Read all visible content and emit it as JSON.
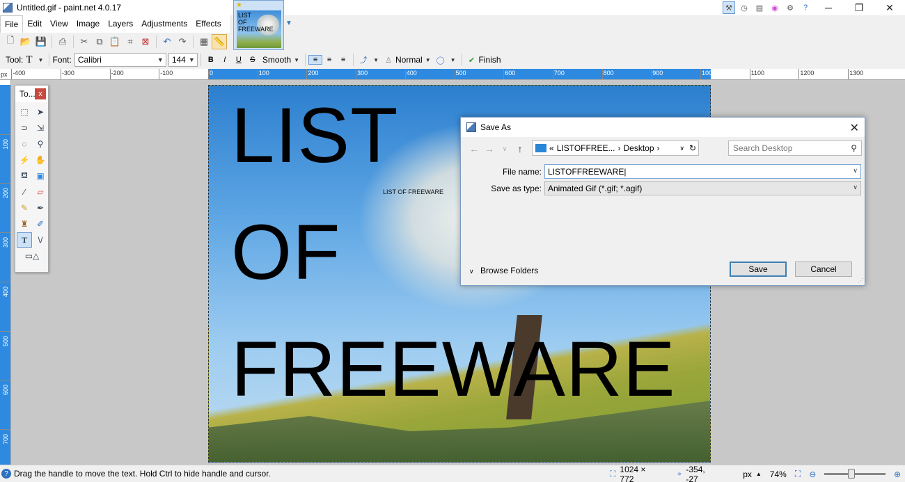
{
  "window": {
    "title": "Untitled.gif - paint.net 4.0.17",
    "minimize": "─",
    "restore": "❐",
    "close": "✕"
  },
  "menu": [
    "File",
    "Edit",
    "View",
    "Image",
    "Layers",
    "Adjustments",
    "Effects"
  ],
  "image_tab": {
    "thumb_text": "LIST\nOF\nFREEWARE"
  },
  "toolbar2": {
    "tool_label": "Tool:",
    "tool_icon": "T",
    "font_label": "Font:",
    "font_value": "Calibri",
    "size_value": "144",
    "bold": "B",
    "italic": "I",
    "underline": "U",
    "strike": "S",
    "antialias": "Smooth",
    "blend": "Normal",
    "finish": "Finish"
  },
  "ruler": {
    "unit": "px",
    "h_labels": [
      "-400",
      "-300",
      "-200",
      "-100",
      "0",
      "100",
      "200",
      "300",
      "400",
      "500",
      "600",
      "700",
      "800",
      "900",
      "1000",
      "1100",
      "1200",
      "1300"
    ],
    "v_labels": [
      "100",
      "200",
      "300",
      "400",
      "500",
      "600",
      "700"
    ]
  },
  "tools_window": {
    "title": "To...",
    "close": "x",
    "icons": [
      "rectangle-select-icon",
      "move-selection-icon",
      "lasso-select-icon",
      "move-selected-icon",
      "ellipse-select-icon",
      "zoom-icon",
      "magic-wand-icon",
      "pan-icon",
      "paint-bucket-icon",
      "gradient-icon",
      "paintbrush-icon",
      "eraser-icon",
      "pencil-icon",
      "color-picker-icon",
      "clone-stamp-icon",
      "recolor-icon",
      "text-icon",
      "line-curve-icon",
      "shapes-icon"
    ]
  },
  "canvas": {
    "big_text": "LIST\nOF\nFREEWARE",
    "small_text": "LIST OF FREEWARE"
  },
  "dialog": {
    "title": "Save As",
    "breadcrumb_prefix": "«",
    "breadcrumb_1": "LISTOFFREE...",
    "breadcrumb_2": "Desktop",
    "search_placeholder": "Search Desktop",
    "filename_label": "File name:",
    "filename_value": "LISTOFFREEWARE",
    "type_label": "Save as type:",
    "type_value": "Animated Gif (*.gif; *.agif)",
    "browse_folders": "Browse Folders",
    "save": "Save",
    "cancel": "Cancel"
  },
  "status": {
    "message": "Drag the handle to move the text. Hold Ctrl to hide handle and cursor.",
    "image_size": "1024 × 772",
    "cursor_pos": "-354, -27",
    "unit": "px",
    "zoom": "74%",
    "zoom_level": 0.44
  },
  "colors": {
    "accent": "#2d8ae0",
    "close_red": "#c84a3e"
  }
}
